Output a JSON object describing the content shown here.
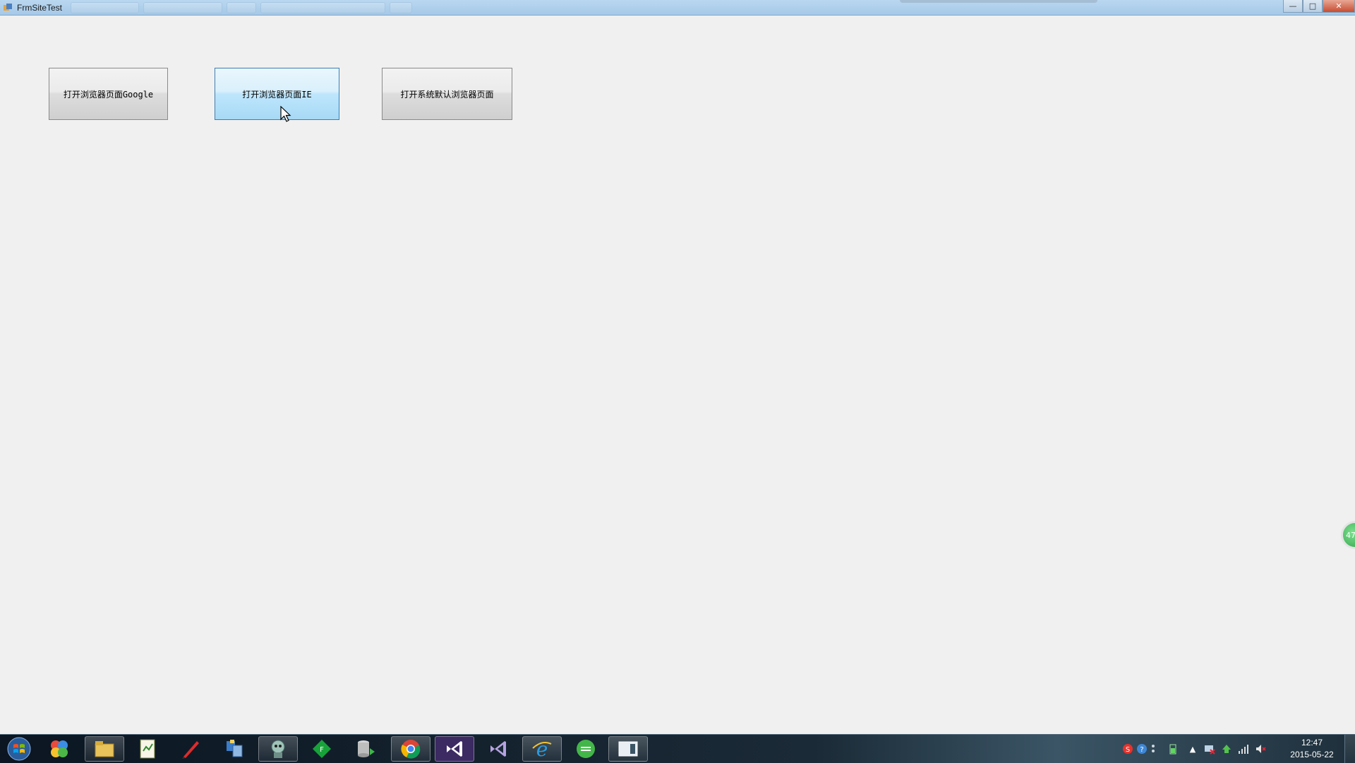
{
  "window": {
    "title": "FrmSiteTest",
    "controls": {
      "minimize": "—",
      "maximize": "□",
      "close": "✕"
    }
  },
  "form": {
    "buttons": [
      {
        "label": "打开浏览器页面Google"
      },
      {
        "label": "打开浏览器页面IE"
      },
      {
        "label": "打开系统默认浏览器页面"
      }
    ]
  },
  "float_widget": {
    "text": "47"
  },
  "taskbar": {
    "apps": [
      "pinwheel-app-icon",
      "file-explorer-icon",
      "notepad-icon",
      "pen-icon",
      "network-app-icon",
      "robot-app-icon",
      "green-diamond-app-icon",
      "database-app-icon",
      "chrome-icon",
      "visual-studio-icon",
      "visual-studio-alt-icon",
      "internet-explorer-icon",
      "refresh-app-icon",
      "window-app-icon"
    ],
    "clock": {
      "time": "12:47",
      "date": "2015-05-22"
    }
  },
  "colors": {
    "form_bg": "#f0f0f0",
    "button_hover": "#a7d9f5",
    "titlebar": "#b9d7f0"
  }
}
